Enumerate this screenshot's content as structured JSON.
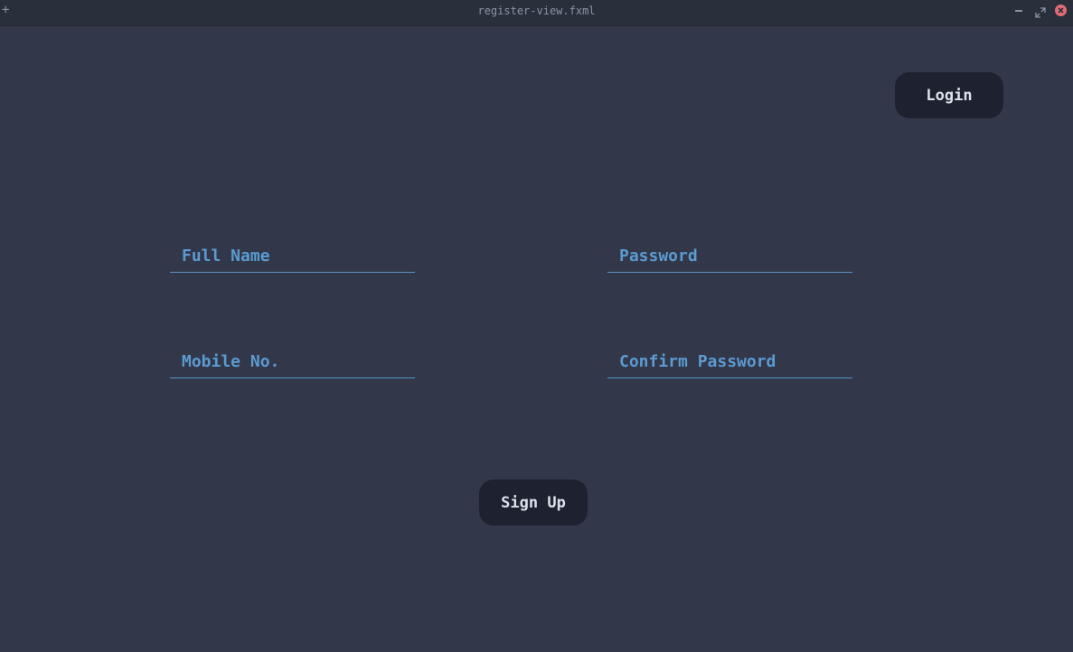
{
  "window": {
    "title": "register-view.fxml",
    "new_symbol": "+"
  },
  "header": {
    "login_label": "Login"
  },
  "form": {
    "full_name_placeholder": "Full Name",
    "mobile_placeholder": "Mobile No.",
    "password_placeholder": "Password",
    "confirm_password_placeholder": "Confirm Password",
    "signup_label": "Sign Up"
  },
  "icons": {
    "new": "plus-icon",
    "minimize": "minimize-icon",
    "maximize": "maximize-icon",
    "close": "close-icon"
  },
  "colors": {
    "background": "#323849",
    "titlebar": "#2a2f3c",
    "button": "#1d2130",
    "accent": "#5b9bd1",
    "close": "#e06c75"
  }
}
